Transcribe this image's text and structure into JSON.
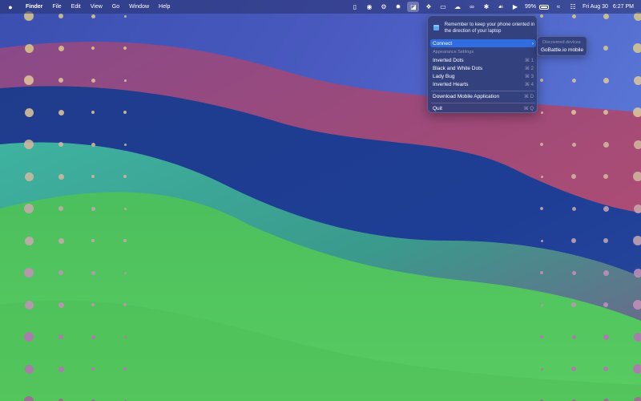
{
  "menubar": {
    "app_name": "Finder",
    "menus": [
      "File",
      "Edit",
      "View",
      "Go",
      "Window",
      "Help"
    ],
    "battery_percent": "99%",
    "date": "Fri Aug 30",
    "time": "6:27 PM"
  },
  "app_menu": {
    "tip": "Remember to keep your phone oriented in the direction of your laptop",
    "connect_label": "Connect",
    "section_label": "Appearance Settings",
    "appearance_items": [
      {
        "label": "Inverted Dots",
        "shortcut": "⌘ 1"
      },
      {
        "label": "Black and White Dots",
        "shortcut": "⌘ 2"
      },
      {
        "label": "Lady Bug",
        "shortcut": "⌘ 3"
      },
      {
        "label": "Inverted Hearts",
        "shortcut": "⌘ 4"
      }
    ],
    "download_label": "Download Mobile Application",
    "download_shortcut": "⌘ D",
    "quit_label": "Quit",
    "quit_shortcut": "⌘ Q"
  },
  "submenu": {
    "header": "Discovered devices",
    "device": "GoBattle.io mobile"
  },
  "colors": {
    "highlight": "#2f6de0",
    "menu_background": "#323e78"
  }
}
